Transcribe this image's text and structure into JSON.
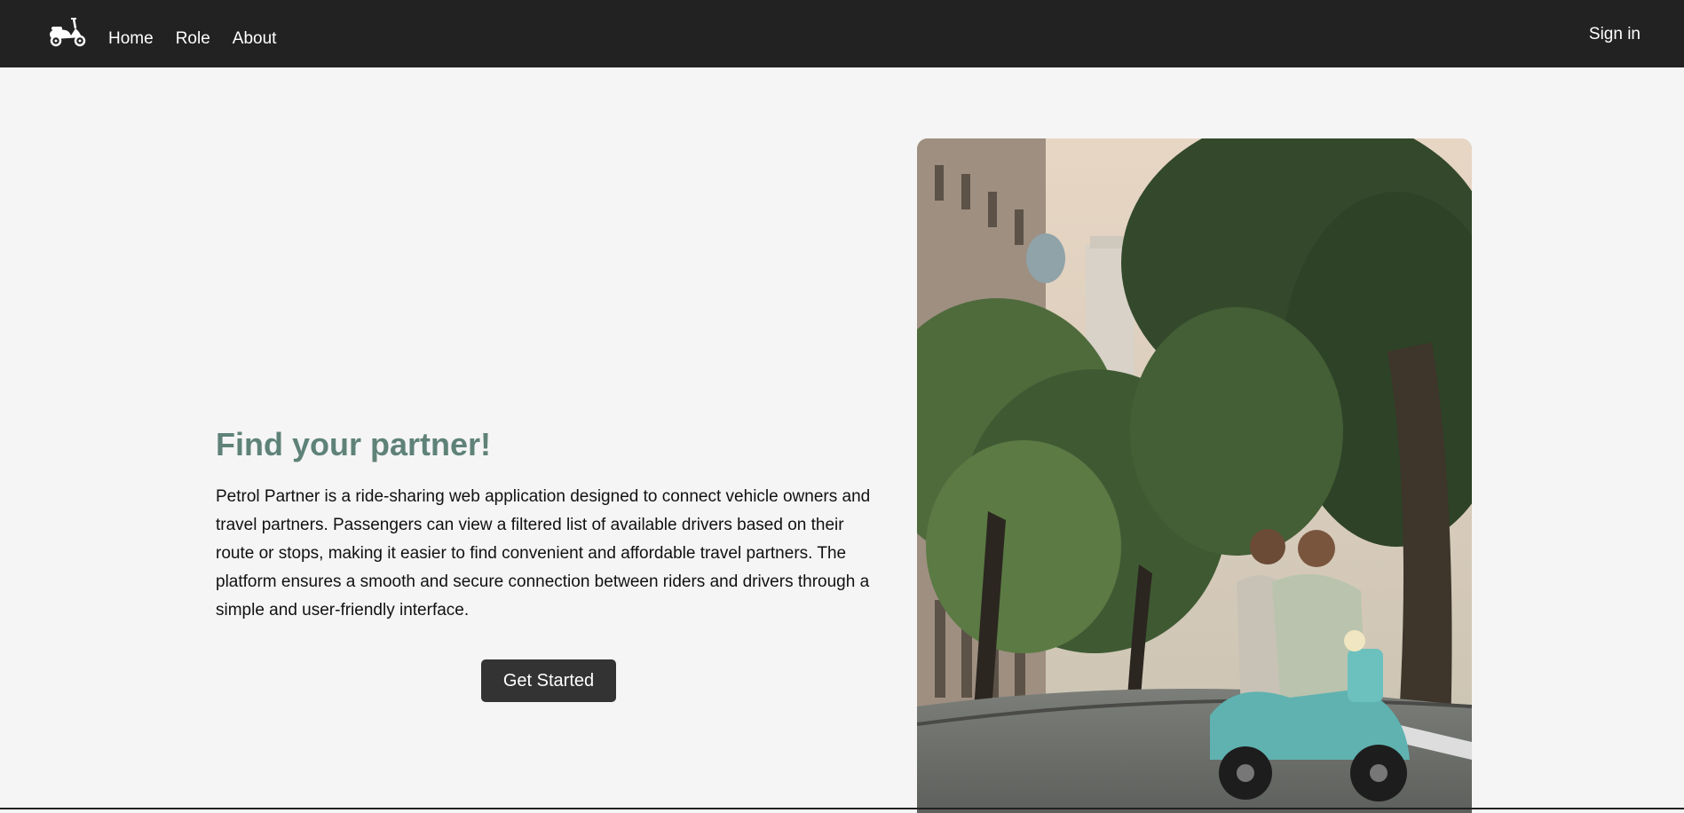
{
  "nav": {
    "brand_icon": "scooter-icon",
    "links": [
      {
        "label": "Home"
      },
      {
        "label": "Role"
      },
      {
        "label": "About"
      }
    ],
    "sign_in": "Sign in"
  },
  "hero": {
    "title": "Find your partner!",
    "description": "Petrol Partner is a ride-sharing web application designed to connect vehicle owners and travel partners. Passengers can view a filtered list of available drivers based on their route or stops, making it easier to find convenient and affordable travel partners. The platform ensures a smooth and secure connection between riders and drivers through a simple and user-friendly interface.",
    "cta": "Get Started"
  },
  "colors": {
    "nav_bg": "#222222",
    "title": "#5f8278",
    "button_bg": "#333333",
    "page_bg": "#f5f5f5"
  }
}
